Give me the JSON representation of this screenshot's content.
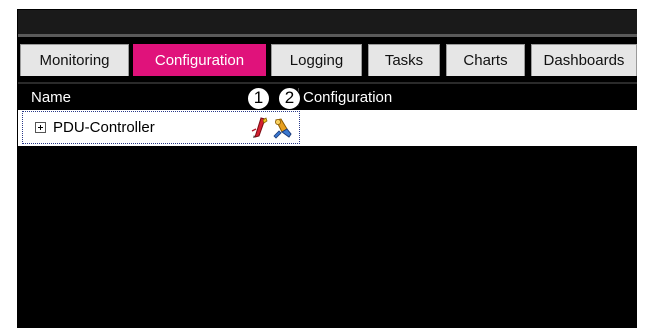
{
  "tabs": [
    {
      "label": "Monitoring",
      "active": false
    },
    {
      "label": "Configuration",
      "active": true
    },
    {
      "label": "Logging",
      "active": false
    },
    {
      "label": "Tasks",
      "active": false
    },
    {
      "label": "Charts",
      "active": false
    },
    {
      "label": "Dashboards",
      "active": false
    }
  ],
  "columns": {
    "name": "Name",
    "configuration": "Configuration"
  },
  "callouts": [
    "1",
    "2"
  ],
  "tree": {
    "node_label": "PDU-Controller",
    "expanded": false
  },
  "icons": {
    "callout_1": "tag-edit-icon",
    "callout_2": "configure-tools-icon"
  },
  "colors": {
    "active_tab": "#e0127b",
    "background": "#000000",
    "row_background": "#ffffff",
    "selection": "#2a3a8a"
  }
}
